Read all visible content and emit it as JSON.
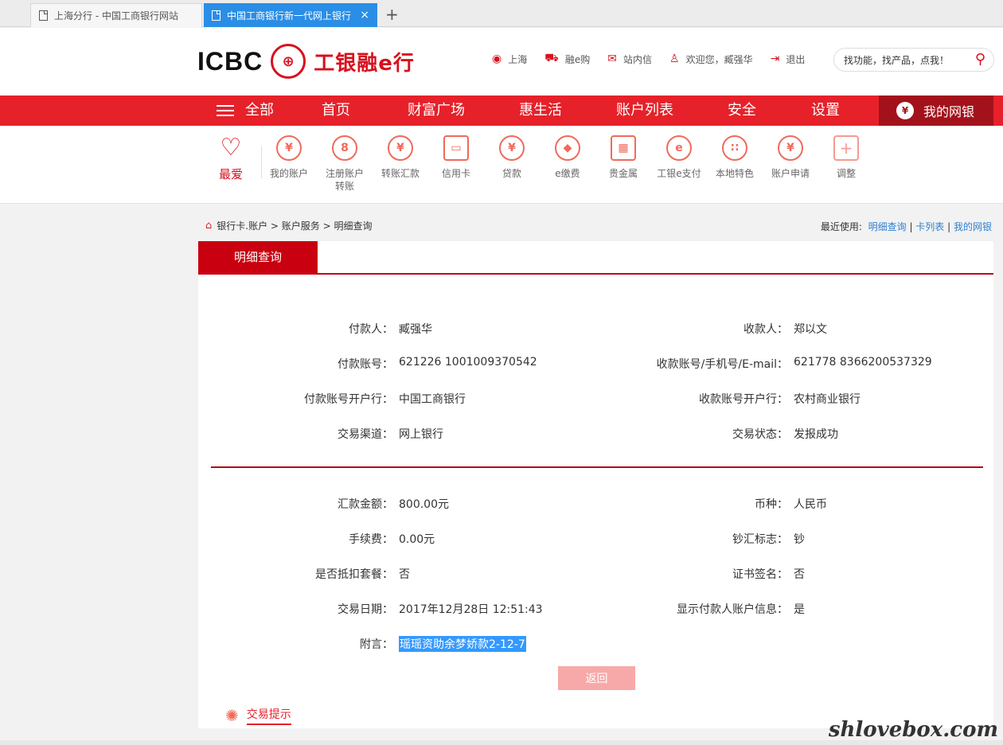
{
  "browser": {
    "tabs": [
      {
        "title": "上海分行 - 中国工商银行网站"
      },
      {
        "title": "中国工商银行新一代网上银行"
      }
    ],
    "close_glyph": "×",
    "new_tab_glyph": "+"
  },
  "header": {
    "logo_icbc": "ICBC",
    "logo_seal": "⊕",
    "logo_cn": "工银融e行",
    "links": [
      "上海",
      "融e购",
      "站内信",
      "欢迎您，臧强华",
      "退出"
    ],
    "search_placeholder": "找功能，找产品，点我！"
  },
  "mainnav": {
    "items": [
      "全部",
      "首页",
      "财富广场",
      "惠生活",
      "账户列表",
      "安全",
      "设置"
    ],
    "mybank": "我的网银"
  },
  "quick": {
    "fav_label": "最爱",
    "items": [
      {
        "label": "我的账户",
        "glyph": "¥",
        "icon": "yen-circle-icon"
      },
      {
        "label": "注册账户转账",
        "glyph": "8",
        "icon": "transfer-circle-icon"
      },
      {
        "label": "转账汇款",
        "glyph": "¥",
        "icon": "remit-circle-icon"
      },
      {
        "label": "信用卡",
        "glyph": "▭",
        "icon": "credit-card-icon"
      },
      {
        "label": "贷款",
        "glyph": "¥",
        "icon": "loan-bag-icon"
      },
      {
        "label": "e缴费",
        "glyph": "◆",
        "icon": "payment-drop-icon"
      },
      {
        "label": "贵金属",
        "glyph": "▦",
        "icon": "gold-bars-icon"
      },
      {
        "label": "工银e支付",
        "glyph": "e",
        "icon": "epay-icon"
      },
      {
        "label": "本地特色",
        "glyph": "∷",
        "icon": "local-feature-icon"
      },
      {
        "label": "账户申请",
        "glyph": "¥",
        "icon": "account-apply-icon"
      },
      {
        "label": "调整",
        "glyph": "+",
        "icon": "adjust-plus-icon"
      }
    ]
  },
  "breadcrumb": {
    "path": "银行卡.账户 > 账户服务 > 明细查询",
    "recent_label": "最近使用:",
    "recent": [
      "明细查询",
      "卡列表",
      "我的网银"
    ]
  },
  "panel": {
    "tab": "明细查询",
    "rows": [
      {
        "ll": "付款人：",
        "lv": "臧强华",
        "rl": "收款人：",
        "rv": "郑以文"
      },
      {
        "ll": "付款账号：",
        "lv": "621226 1001009370542",
        "rl": "收款账号/手机号/E-mail：",
        "rv": "621778 8366200537329"
      },
      {
        "ll": "付款账号开户行：",
        "lv": "中国工商银行",
        "rl": "收款账号开户行：",
        "rv": "农村商业银行"
      },
      {
        "ll": "交易渠道：",
        "lv": "网上银行",
        "rl": "交易状态：",
        "rv": "发报成功"
      },
      {
        "ll": "汇款金额：",
        "lv": "800.00元",
        "rl": "币种：",
        "rv": "人民币"
      },
      {
        "ll": "手续费：",
        "lv": "0.00元",
        "rl": "钞汇标志：",
        "rv": "钞"
      },
      {
        "ll": "是否抵扣套餐：",
        "lv": "否",
        "rl": "证书签名：",
        "rv": "否"
      },
      {
        "ll": "交易日期：",
        "lv": "2017年12月28日 12:51:43",
        "rl": "显示付款人账户信息：",
        "rv": "是"
      }
    ],
    "note_label": "附言：",
    "note_value": "瑶瑶资助余梦娇款2-12-7",
    "back_button": "返回",
    "tips": "交易提示"
  },
  "watermark": "shlovebox.com"
}
